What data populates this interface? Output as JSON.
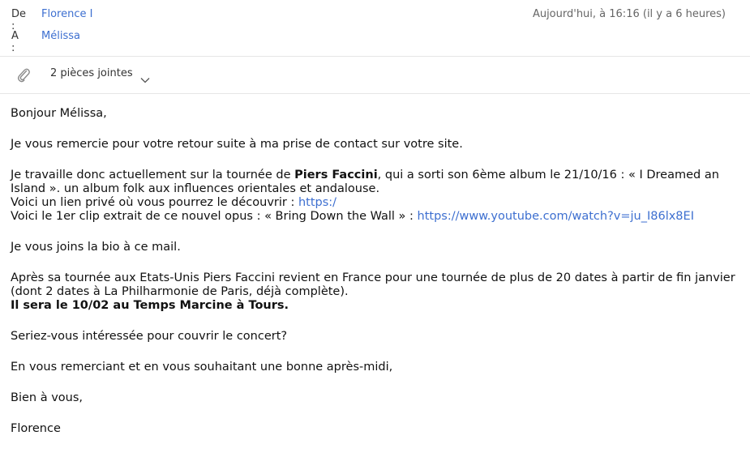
{
  "header": {
    "from_label": "De :",
    "from_value": "Florence I",
    "to_label": "A :",
    "to_value": "Mélissa",
    "date": "Aujourd'hui, à 16:16 (il y a 6 heures)"
  },
  "attachments": {
    "label": "2 pièces jointes",
    "icon": "paperclip-icon",
    "toggle_icon": "chevron-down-icon"
  },
  "message": {
    "greeting": "Bonjour Mélissa,",
    "p1": "Je vous remercie pour votre retour suite à ma prise de contact sur votre site.",
    "p2_before": "Je travaille donc actuellement sur la tournée de ",
    "p2_bold": "Piers Faccini",
    "p2_after": ", qui a sorti son 6ème album le 21/10/16 : « I Dreamed an",
    "p2_line2": "Island ». un album folk aux influences orientales et andalouse.",
    "p2_line3_text": "Voici un lien privé où vous pourrez le découvrir : ",
    "p2_line3_link": "https:/",
    "p2_line4_text": "Voici le 1er clip extrait de ce nouvel opus : « Bring Down the Wall » : ",
    "p2_line4_link": "https://www.youtube.com/watch?v=ju_I86lx8EI",
    "p3": "Je vous joins la bio à ce mail.",
    "p4_line1": "Après sa tournée aux Etats-Unis Piers Faccini revient en France pour une tournée de plus de 20 dates à partir de fin janvier",
    "p4_line2": "(dont 2 dates à La Philharmonie de Paris, déjà complète).",
    "p4_line3": "Il sera le 10/02 au Temps Marcine à Tours.",
    "p5": "Seriez-vous intéressée pour couvrir le concert?",
    "p6": "En vous remerciant et en vous souhaitant une bonne après-midi,",
    "closing": "Bien à vous,",
    "signature": "Florence"
  },
  "colors": {
    "link": "#3d6fd0",
    "divider": "#e6e6e6",
    "muted": "#666666"
  }
}
